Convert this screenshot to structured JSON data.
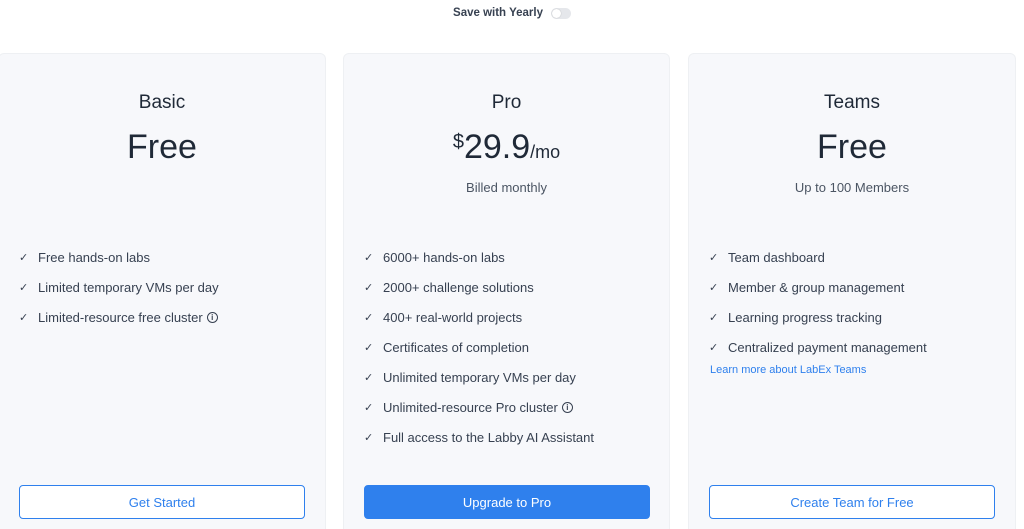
{
  "toggle": {
    "label": "Save with Yearly",
    "enabled": false
  },
  "plans": [
    {
      "name": "Basic",
      "price": "Free",
      "features": [
        "Free hands-on labs",
        "Limited temporary VMs per day",
        "Limited-resource free cluster"
      ],
      "button": "Get Started"
    },
    {
      "name": "Pro",
      "currency": "$",
      "amount": "29.9",
      "period": "/mo",
      "billing": "Billed monthly",
      "features": [
        "6000+ hands-on labs",
        "2000+ challenge solutions",
        "400+ real-world projects",
        "Certificates of completion",
        "Unlimited temporary VMs per day",
        "Unlimited-resource Pro cluster",
        "Full access to the Labby AI Assistant"
      ],
      "button": "Upgrade to Pro"
    },
    {
      "name": "Teams",
      "price": "Free",
      "members": "Up to 100 Members",
      "features": [
        "Team dashboard",
        "Member & group management",
        "Learning progress tracking",
        "Centralized payment management"
      ],
      "link": "Learn more about LabEx Teams",
      "button": "Create Team for Free"
    }
  ],
  "icons": {
    "check": "check-icon",
    "info": "info-icon"
  },
  "colors": {
    "accent": "#2f80ed",
    "card_bg": "#f7f8fb"
  }
}
